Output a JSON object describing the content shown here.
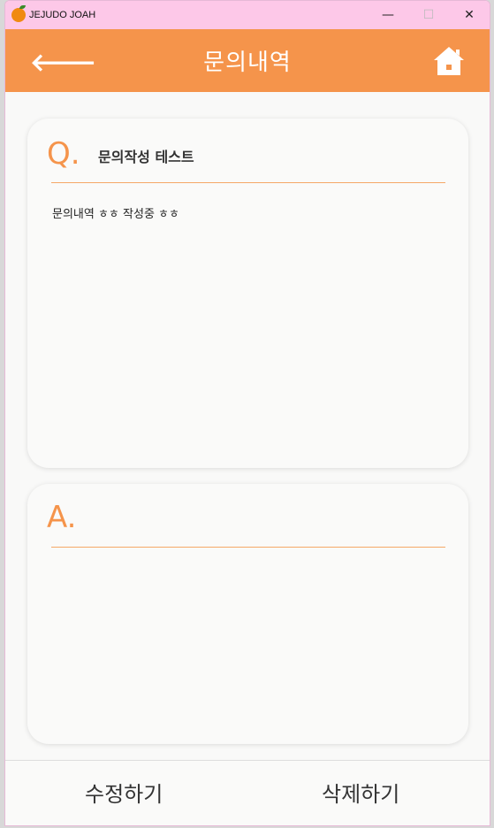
{
  "window": {
    "title": "JEJUDO JOAH",
    "minimize": "—",
    "maximize": "☐",
    "close": "✕"
  },
  "header": {
    "title": "문의내역",
    "back_icon": "arrow-left",
    "home_icon": "home"
  },
  "question": {
    "mark": "Q.",
    "title": "문의작성 테스트",
    "body": "문의내역 ㅎㅎ 작성중 ㅎㅎ"
  },
  "answer": {
    "mark": "A.",
    "body": ""
  },
  "actions": {
    "edit": "수정하기",
    "delete": "삭제하기"
  },
  "colors": {
    "accent": "#f5944b",
    "titlebar": "#fdc8e8"
  }
}
